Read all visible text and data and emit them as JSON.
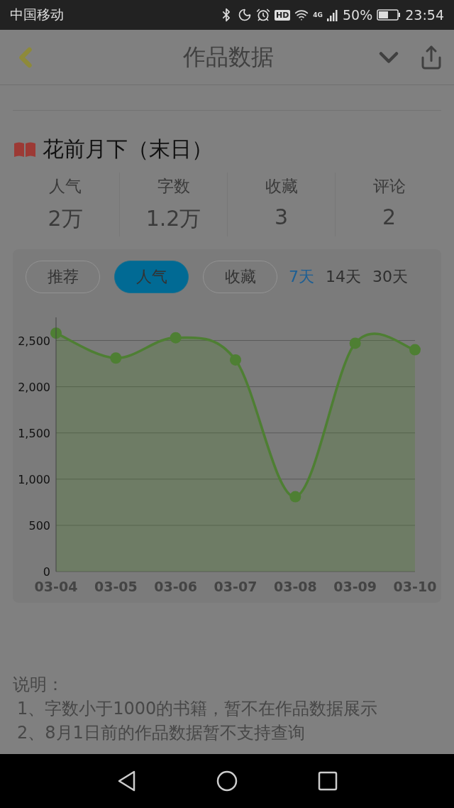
{
  "status_bar": {
    "carrier": "中国移动",
    "hd": "HD",
    "network": "4G",
    "battery": "50%",
    "time": "23:54"
  },
  "header": {
    "title": "作品数据"
  },
  "book": {
    "title": "花前月下（末日）"
  },
  "stats": [
    {
      "label": "人气",
      "value": "2万"
    },
    {
      "label": "字数",
      "value": "1.2万"
    },
    {
      "label": "收藏",
      "value": "3"
    },
    {
      "label": "评论",
      "value": "2"
    }
  ],
  "metric_tabs": [
    {
      "label": "推荐",
      "selected": false
    },
    {
      "label": "人气",
      "selected": true
    },
    {
      "label": "收藏",
      "selected": false
    }
  ],
  "range_tabs": [
    {
      "label": "7天",
      "selected": true
    },
    {
      "label": "14天",
      "selected": false
    },
    {
      "label": "30天",
      "selected": false
    }
  ],
  "chart_data": {
    "type": "area",
    "categories": [
      "03-04",
      "03-05",
      "03-06",
      "03-07",
      "03-08",
      "03-09",
      "03-10"
    ],
    "grid": true,
    "series": [
      {
        "color": "#4e7f33",
        "values": [
          2580,
          2310,
          2530,
          2290,
          810,
          2470,
          2400
        ]
      }
    ],
    "ylim": [
      0,
      2750
    ],
    "yticks": [
      {
        "value": 0,
        "label": "0"
      },
      {
        "value": 500,
        "label": "500"
      },
      {
        "value": 1000,
        "label": "1,000"
      },
      {
        "value": 1500,
        "label": "1,500"
      },
      {
        "value": 2000,
        "label": "2,000"
      },
      {
        "value": 2500,
        "label": "2,500"
      }
    ]
  },
  "notes": {
    "heading": "说明：",
    "lines": [
      "1、字数小于1000的书籍，暂不在作品数据展示",
      "2、8月1日前的作品数据暂不支持查询"
    ]
  }
}
